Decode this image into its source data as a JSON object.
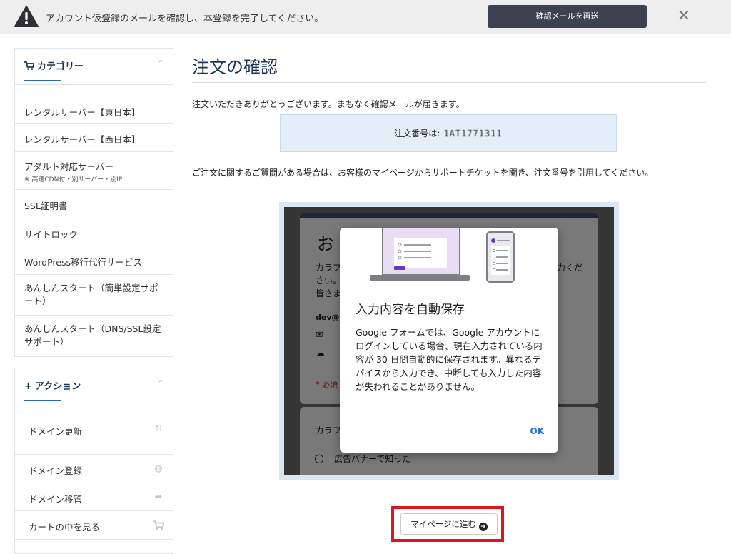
{
  "banner": {
    "message": "アカウント仮登録のメールを確認し、本登録を完了してください。",
    "resend_label": "確認メールを再送",
    "close_symbol": "✕"
  },
  "sidebar": {
    "category": {
      "title": "カテゴリー",
      "items": [
        {
          "label": "レンタルサーバー【東日本】",
          "sub": ""
        },
        {
          "label": "レンタルサーバー【西日本】",
          "sub": ""
        },
        {
          "label": "アダルト対応サーバー",
          "sub": "※ 高速CDN付・別サーバー・別IP"
        },
        {
          "label": "SSL証明書",
          "sub": ""
        },
        {
          "label": "サイトロック",
          "sub": ""
        },
        {
          "label": "WordPress移行代行サービス",
          "sub": ""
        },
        {
          "label": "あんしんスタート（簡単設定サポート）",
          "sub": ""
        },
        {
          "label": "あんしんスタート（DNS/SSL設定サポート）",
          "sub": ""
        }
      ]
    },
    "action": {
      "title": "アクション",
      "items": [
        {
          "label": "ドメイン更新",
          "icon": "refresh-icon"
        },
        {
          "label": "ドメイン登録",
          "icon": "globe-icon"
        },
        {
          "label": "ドメイン移管",
          "icon": "share-arrow-icon"
        },
        {
          "label": "カートの中を見る",
          "icon": "cart-icon"
        }
      ]
    }
  },
  "main": {
    "title": "注文の確認",
    "thanks": "注文いただきありがとうございます。まもなく確認メールが届きます。",
    "order_label": "注文番号は:",
    "order_number": "1AT1771311",
    "question": "ご注文に関するご質問がある場合は、お客様のマイページからサポートチケットを開き、注文番号を引用してください。",
    "cta_label": "マイページに進む"
  },
  "embedded": {
    "bg_heading": "お",
    "bg_line1": "カラフ",
    "bg_line2": "さい。",
    "bg_line3": "皆さま",
    "bg_right": "力くだ",
    "bg_email": "dev@",
    "bg_required": "* 必須",
    "bg_q": "カラフ",
    "bg_option": "広告バナーで知った",
    "dialog_title": "入力内容を自動保存",
    "dialog_body": "Google フォームでは、Google アカウントにログインしている場合、現在入力されている内容が 30 日間自動的に保存されます。異なるデバイスから入力でき、中断しても入力した内容が失われることがありません。",
    "dialog_ok": "OK"
  }
}
